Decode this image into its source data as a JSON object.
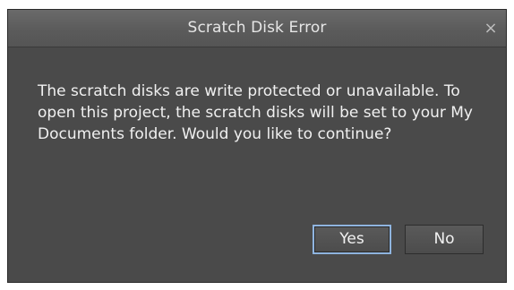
{
  "dialog": {
    "title": "Scratch Disk Error",
    "close_glyph": "×",
    "close_icon": "close-icon",
    "message": "The scratch disks are write protected or unavailable. To open this project, the scratch disks will be set to your My Documents folder. Would you like to continue?",
    "buttons": {
      "yes_label": "Yes",
      "no_label": "No"
    }
  },
  "colors": {
    "dialog_background": "#4a4a4a",
    "titlebar_background": "#5b5b5b",
    "text": "#f0f0f0",
    "focus_ring": "#8fb4df"
  }
}
